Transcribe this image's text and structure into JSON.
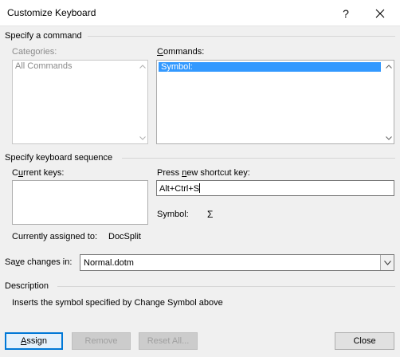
{
  "window": {
    "title": "Customize Keyboard",
    "help_glyph": "?",
    "close_icon": "close-icon"
  },
  "specify_command": {
    "heading": "Specify a command",
    "categories_label": "Categories:",
    "categories_items": [
      "All Commands"
    ],
    "commands_label_pre": "",
    "commands_label_u": "C",
    "commands_label_post": "ommands:",
    "commands_items": [
      "Symbol:"
    ],
    "selected_command": "Symbol:"
  },
  "keyboard_sequence": {
    "heading": "Specify keyboard sequence",
    "current_keys_label_pre": "C",
    "current_keys_label_u": "u",
    "current_keys_label_post": "rrent keys:",
    "new_key_label_pre": "Press ",
    "new_key_label_u": "n",
    "new_key_label_post": "ew shortcut key:",
    "new_key_value": "Alt+Ctrl+S",
    "symbol_label": "Symbol:",
    "symbol_value": "Σ",
    "assigned_label": "Currently assigned to:",
    "assigned_value": "DocSplit"
  },
  "save_changes": {
    "label_pre": "Sa",
    "label_u": "v",
    "label_post": "e changes in:",
    "value": "Normal.dotm"
  },
  "description": {
    "heading": "Description",
    "text": "Inserts the symbol specified by Change Symbol above"
  },
  "buttons": {
    "assign_u": "A",
    "assign_rest": "ssign",
    "remove": "Remove",
    "reset_all": "Reset All...",
    "close": "Close"
  },
  "colors": {
    "selection": "#3399ff",
    "default_button_border": "#0078d7"
  }
}
